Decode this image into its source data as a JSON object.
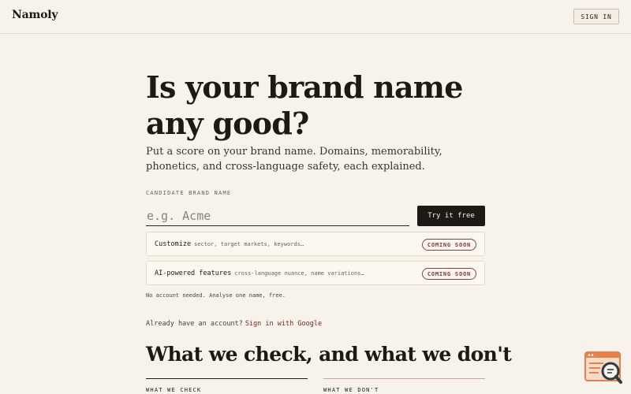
{
  "header": {
    "logo": "Namoly",
    "signin_label": "SIGN IN"
  },
  "hero": {
    "title": "Is your brand name any good?",
    "subtitle": "Put a score on your brand name. Domains, memorability, phonetics, and cross-language safety, each explained.",
    "field_label": "CANDIDATE BRAND NAME",
    "input_value": "",
    "input_placeholder": "e.g. Acme",
    "try_label": "Try it free"
  },
  "options": [
    {
      "title": "Customize",
      "hint": "sector, target markets, keywords…",
      "badge": "COMING SOON"
    },
    {
      "title": "AI-powered features",
      "hint": "cross-language nuance, name variations…",
      "badge": "COMING SOON"
    }
  ],
  "note": "No account needed. Analyse one name, free.",
  "signin_prompt": {
    "text": "Already have an account?",
    "link": "Sign in with Google"
  },
  "section": {
    "title": "What we check, and what we don't",
    "col_left": "WHAT WE CHECK",
    "col_right": "WHAT WE DON'T"
  },
  "colors": {
    "background": "#f7f2ea",
    "text": "#1d1915",
    "accent": "#8c2f2f",
    "widget_orange": "#e8804a"
  },
  "icons": {
    "help_widget": "chat-search-icon"
  }
}
